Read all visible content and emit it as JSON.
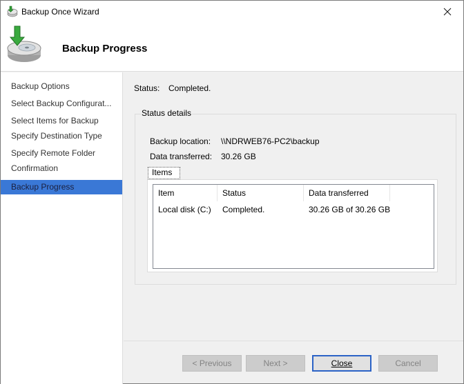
{
  "window": {
    "title": "Backup Once Wizard",
    "title_icon": "backup-wizard-icon",
    "close_glyph": "✕"
  },
  "header": {
    "title": "Backup Progress",
    "icon": "disk-backup-icon"
  },
  "sidebar": {
    "items": [
      {
        "label": "Backup Options",
        "active": false
      },
      {
        "label": "Select Backup Configurat...",
        "active": false
      },
      {
        "label": "Select Items for Backup",
        "active": false
      },
      {
        "label": "Specify Destination Type",
        "active": false
      },
      {
        "label": "Specify Remote Folder",
        "active": false
      },
      {
        "label": "Confirmation",
        "active": false
      },
      {
        "label": "Backup Progress",
        "active": true
      }
    ]
  },
  "main": {
    "status_label": "Status:",
    "status_value": "Completed.",
    "details": {
      "legend": "Status details",
      "backup_location_label": "Backup location:",
      "backup_location_value": "\\\\NDRWEB76-PC2\\backup",
      "data_transferred_label": "Data transferred:",
      "data_transferred_value": "30.26 GB",
      "items_tab": "Items",
      "table": {
        "columns": [
          "Item",
          "Status",
          "Data transferred"
        ],
        "rows": [
          [
            "Local disk (C:)",
            "Completed.",
            "30.26 GB of 30.26 GB"
          ]
        ]
      }
    }
  },
  "buttons": {
    "previous": "< Previous",
    "next": "Next >",
    "close": "Close",
    "cancel": "Cancel"
  },
  "colors": {
    "accent": "#3a78d6",
    "primary_border": "#2a62c6"
  }
}
